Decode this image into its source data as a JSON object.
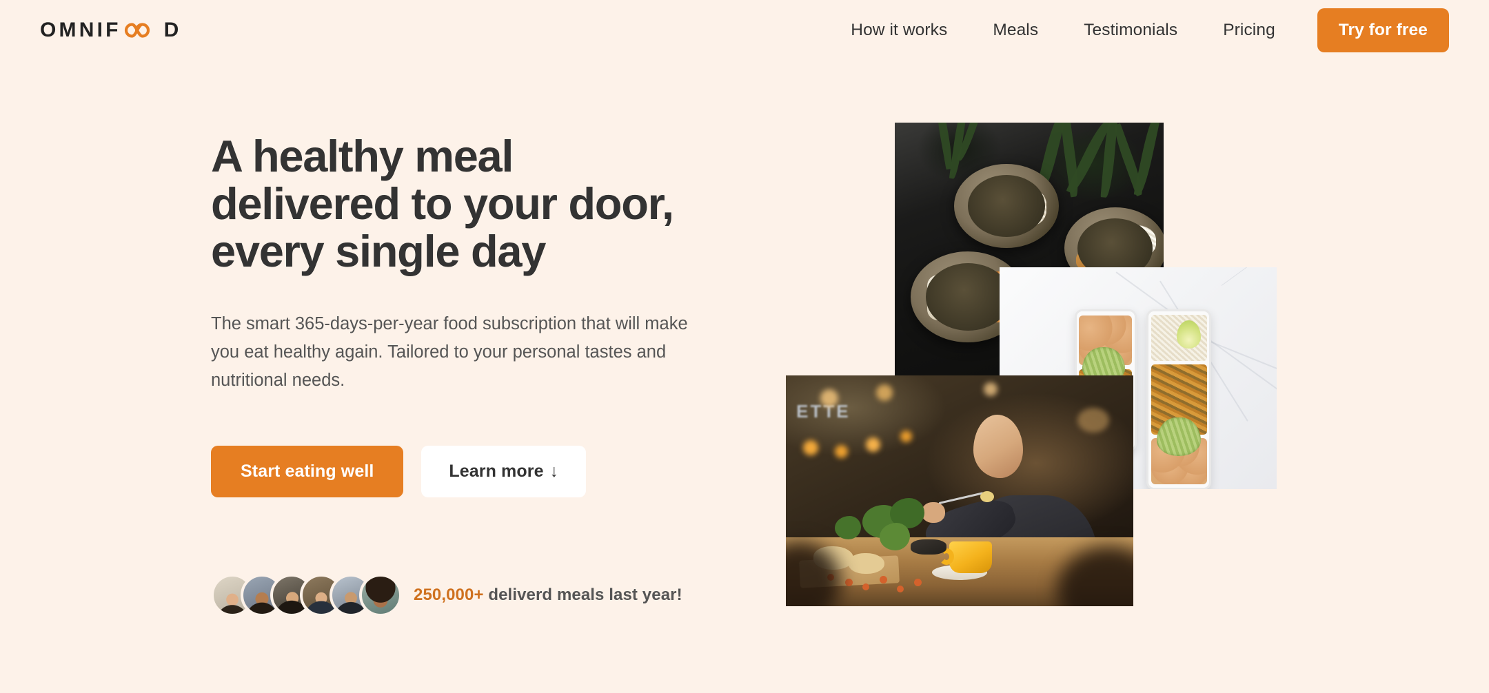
{
  "brand": {
    "name_part1": "OMNIF",
    "name_part2": "D",
    "infinity_icon": "infinity-icon",
    "accent_color": "#e67e22",
    "logo_text_color": "#222222"
  },
  "theme": {
    "background_color": "#fdf2e9",
    "accent_color": "#e67e22",
    "accent_dark": "#cf711f",
    "heading_color": "#333333",
    "body_text_color": "#555555"
  },
  "header": {
    "nav_links": [
      {
        "label": "How it works"
      },
      {
        "label": "Meals"
      },
      {
        "label": "Testimonials"
      },
      {
        "label": "Pricing"
      }
    ],
    "cta_label": "Try for free"
  },
  "hero": {
    "title_lines": [
      "A healthy meal",
      "delivered to your door,",
      "every single day"
    ],
    "description": "The smart 365-days-per-year food subscription that will make you eat healthy again. Tailored to your personal tastes and nutritional needs.",
    "primary_button": "Start eating well",
    "secondary_button": "Learn more",
    "secondary_button_arrow": "↓",
    "delivered": {
      "count": "250,000+",
      "text": " deliverd meals last year!",
      "avatar_count": 6,
      "avatars": [
        {
          "alt": "customer-1"
        },
        {
          "alt": "customer-2"
        },
        {
          "alt": "customer-3"
        },
        {
          "alt": "customer-4"
        },
        {
          "alt": "customer-5"
        },
        {
          "alt": "customer-6"
        }
      ]
    },
    "images": [
      {
        "alt": "Woman enjoying food, meals in storage container, and food bowls on a table"
      },
      {
        "alt": "Meal prep containers with chickpeas, rice and avocado on marble"
      },
      {
        "alt": "Woman eating a healthy meal in a restaurant"
      }
    ]
  }
}
